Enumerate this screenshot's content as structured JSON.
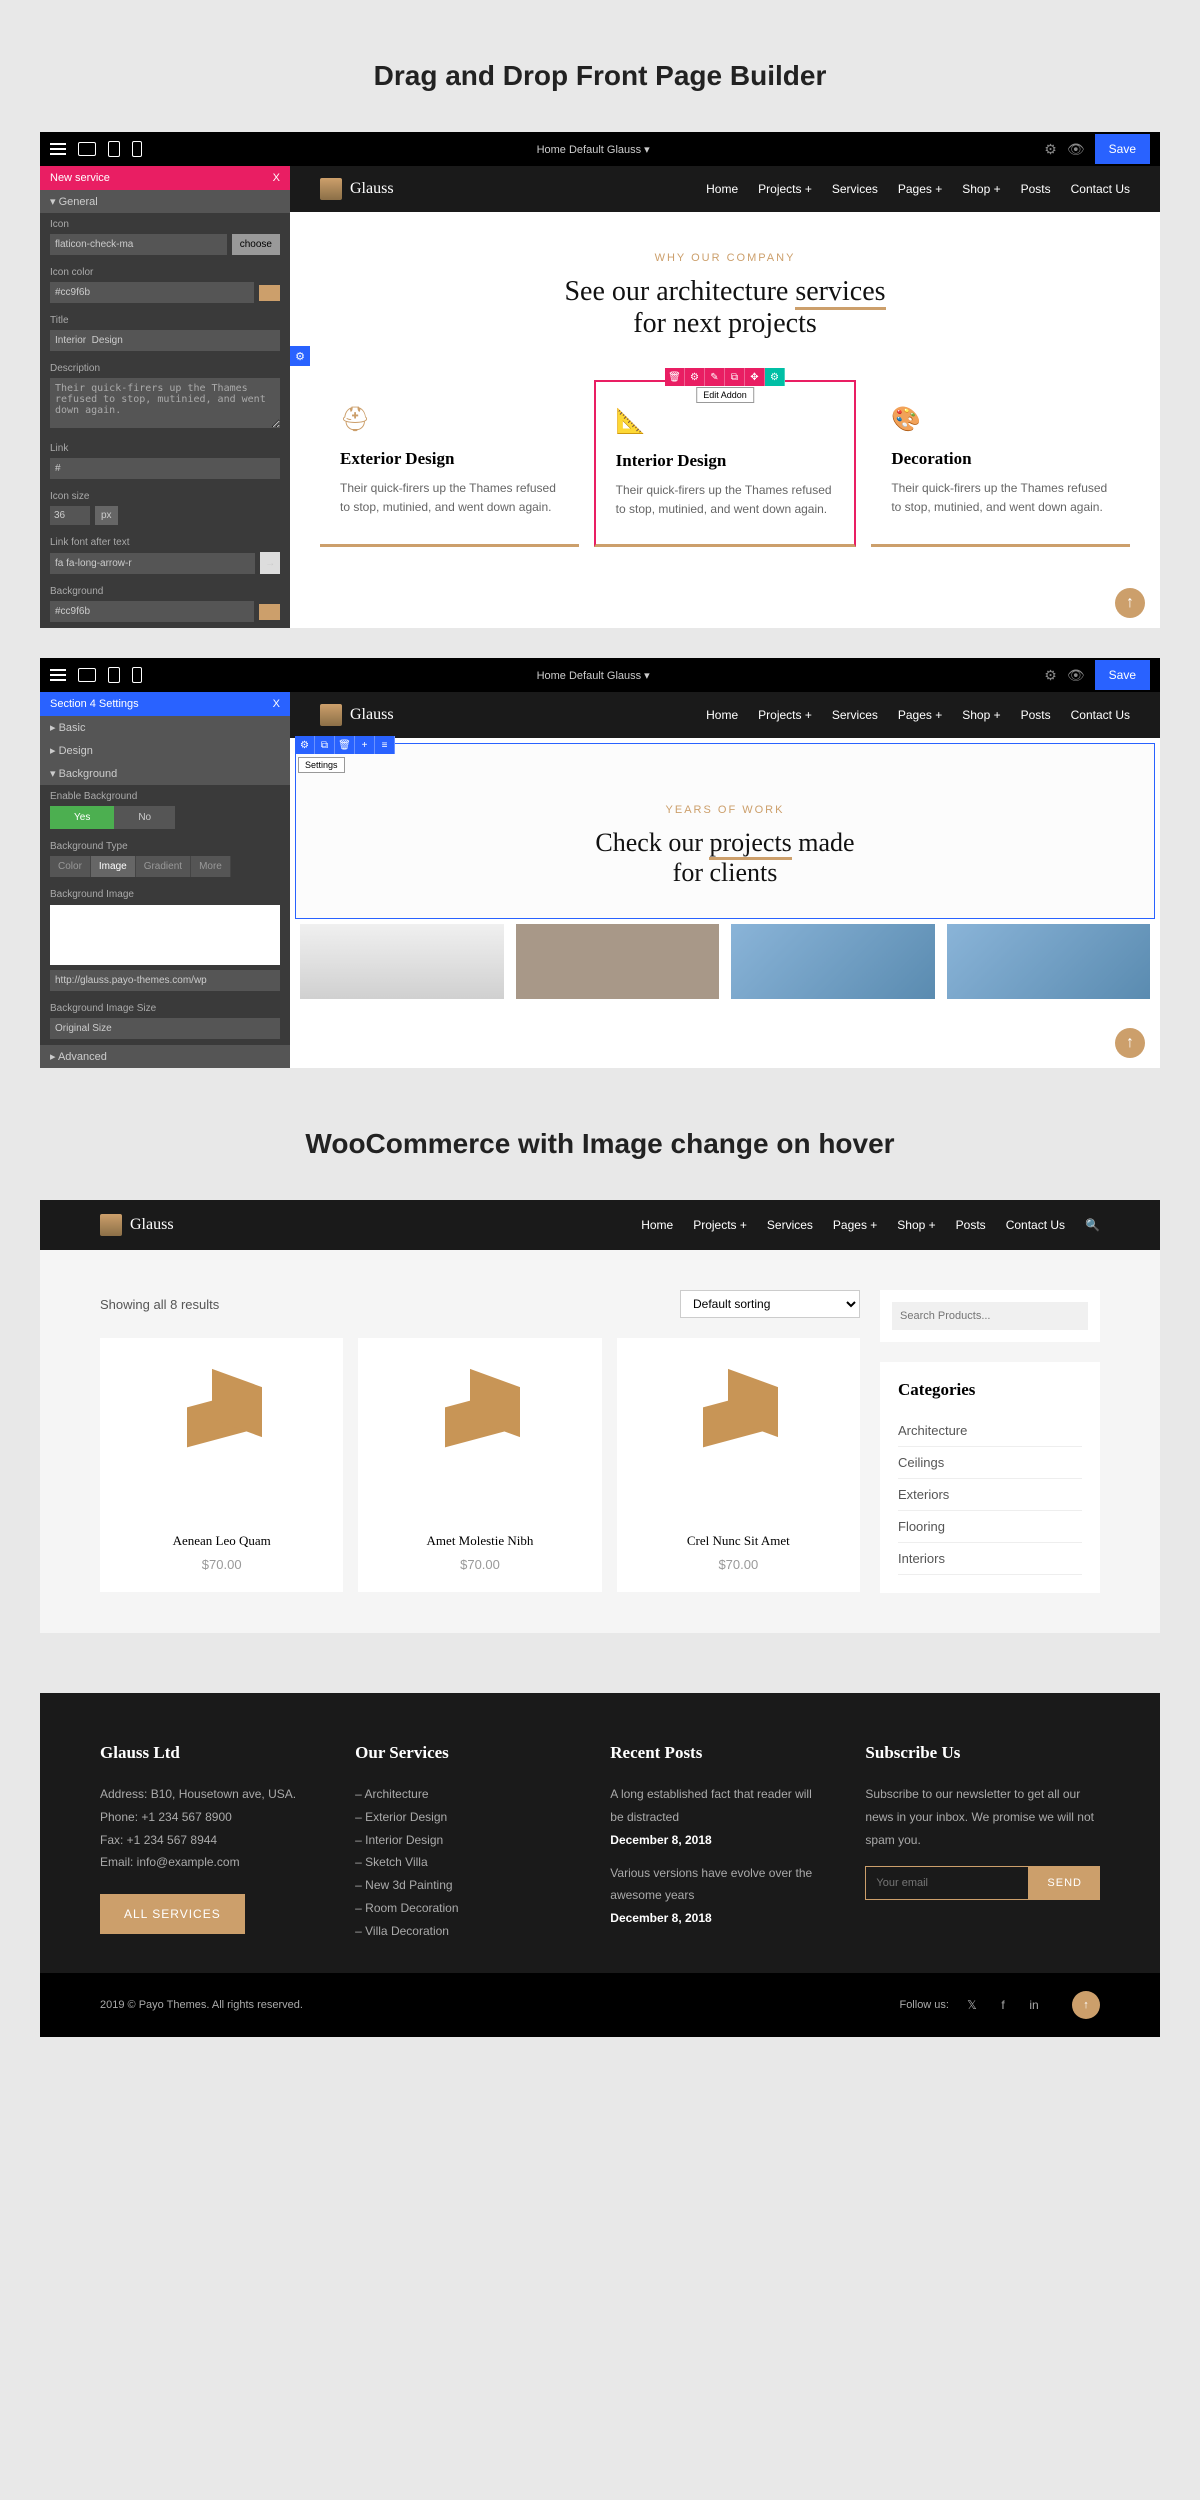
{
  "headings": {
    "builder": "Drag and Drop Front Page Builder",
    "woo": "WooCommerce with Image change on hover"
  },
  "topbar": {
    "page_title": "Home Default Glauss ▾",
    "save": "Save"
  },
  "panel1": {
    "header": "New service",
    "close": "X",
    "general": "▾ General",
    "icon_label": "Icon",
    "icon_value": "flaticon-check-ma",
    "choose": "choose",
    "icon_color_label": "Icon color",
    "icon_color_value": "#cc9f6b",
    "title_label": "Title",
    "title_value": "Interior  Design",
    "desc_label": "Description",
    "desc_value": "Their quick-firers up the Thames refused to stop, mutinied, and went down again.",
    "link_label": "Link",
    "link_value": "#",
    "icon_size_label": "Icon size",
    "icon_size_value": "36",
    "px": "px",
    "link_font_label": "Link font after text",
    "link_font_value": "fa fa-long-arrow-r",
    "bg_label": "Background",
    "bg_value": "#cc9f6b"
  },
  "panel2": {
    "header": "Section 4 Settings",
    "close": "X",
    "basic": "▸ Basic",
    "design": "▸ Design",
    "background": "▾ Background",
    "enable_bg": "Enable Background",
    "yes": "Yes",
    "no": "No",
    "bg_type": "Background Type",
    "color": "Color",
    "image": "Image",
    "gradient": "Gradient",
    "more": "More",
    "bg_image": "Background Image",
    "bg_url": "http://glauss.payo-themes.com/wp",
    "bg_size": "Background Image Size",
    "bg_size_value": "Original Size",
    "advanced": "▸ Advanced"
  },
  "site": {
    "brand": "Glauss",
    "nav": [
      "Home",
      "Projects +",
      "Services",
      "Pages +",
      "Shop +",
      "Posts",
      "Contact Us"
    ]
  },
  "hero1": {
    "sub": "WHY OUR COMPANY",
    "line1a": "See our architecture ",
    "line1b": "services",
    "line2": "for next projects"
  },
  "edit_addon": "Edit Addon",
  "cards": [
    {
      "title": "Exterior Design",
      "desc": "Their quick-firers up the Thames refused to stop, mutinied, and went down again."
    },
    {
      "title": "Interior Design",
      "desc": "Their quick-firers up the Thames refused to stop, mutinied, and went down again."
    },
    {
      "title": "Decoration",
      "desc": "Their quick-firers up the Thames refused to stop, mutinied, and went down again."
    }
  ],
  "hero2": {
    "sub": "YEARS OF WORK",
    "line1a": "Check our ",
    "line1b": "projects",
    "line1c": " made",
    "line2": "for clients",
    "settings": "Settings"
  },
  "woo": {
    "results": "Showing all 8 results",
    "sort": "Default sorting",
    "search_placeholder": "Search Products...",
    "cat_title": "Categories",
    "categories": [
      "Architecture",
      "Ceilings",
      "Exteriors",
      "Flooring",
      "Interiors"
    ],
    "products": [
      {
        "name": "Aenean Leo Quam",
        "price": "$70.00"
      },
      {
        "name": "Amet Molestie Nibh",
        "price": "$70.00"
      },
      {
        "name": "Crel Nunc Sit Amet",
        "price": "$70.00"
      }
    ]
  },
  "footer": {
    "company": {
      "title": "Glauss Ltd",
      "address": "Address: B10, Housetown ave, USA.",
      "phone": "Phone: +1 234 567 8900",
      "fax": "Fax: +1 234 567 8944",
      "email": "Email: info@example.com",
      "btn": "ALL SERVICES"
    },
    "services": {
      "title": "Our Services",
      "items": [
        "– Architecture",
        "– Exterior Design",
        "– Interior Design",
        "– Sketch Villa",
        "– New 3d Painting",
        "– Room Decoration",
        "– Villa Decoration"
      ]
    },
    "posts": {
      "title": "Recent Posts",
      "p1": "A long established fact that reader will be distracted",
      "d1": "December 8, 2018",
      "p2": "Various versions have evolve over the awesome years",
      "d2": "December 8, 2018"
    },
    "subscribe": {
      "title": "Subscribe Us",
      "text": "Subscribe to our newsletter to get all our news in your inbox. We promise we will not spam you.",
      "placeholder": "Your email",
      "btn": "SEND"
    },
    "copyright": "2019 © Payo Themes. All rights reserved.",
    "follow": "Follow us:"
  }
}
